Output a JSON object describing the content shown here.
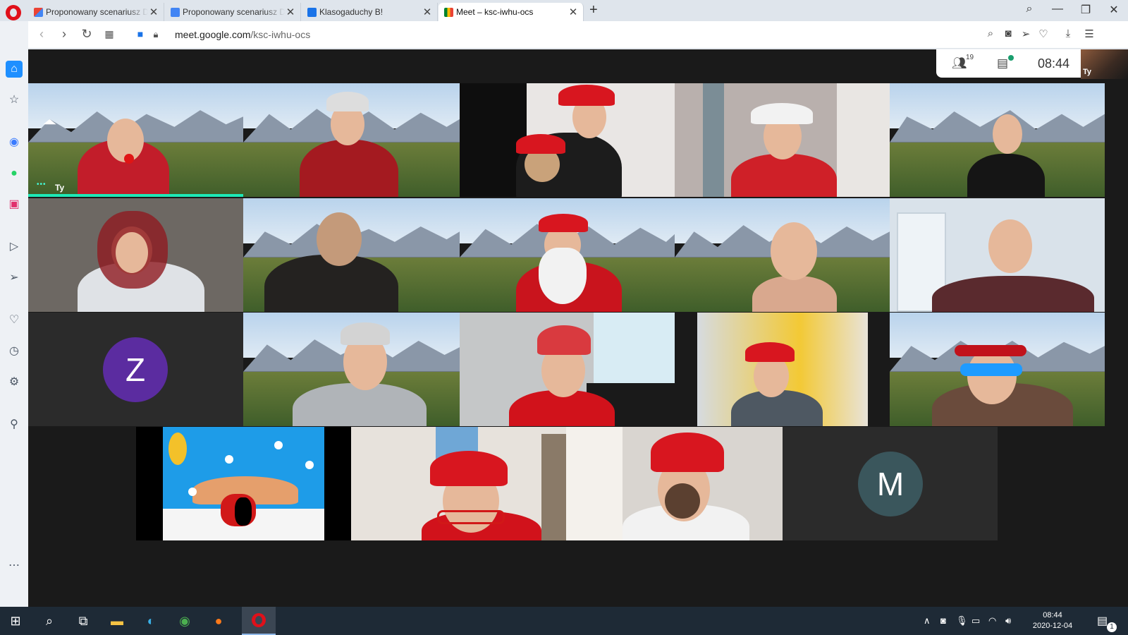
{
  "browser": {
    "tabs": [
      {
        "title": "Proponowany scenariusz D",
        "favicon": "gmail-icon",
        "active": false
      },
      {
        "title": "Proponowany scenariusz D",
        "favicon": "docs-icon",
        "active": false
      },
      {
        "title": "Klasogaduchy B!",
        "favicon": "classroom-icon",
        "active": false
      },
      {
        "title": "Meet – ksc-iwhu-ocs",
        "favicon": "meet-icon",
        "active": true
      }
    ],
    "url_domain": "meet.google.com",
    "url_path": "/ksc-iwhu-ocs",
    "colors": {
      "opera_red": "#e0101a",
      "tab_bg": "#dfe5ec",
      "meet_bg": "#1a1a1a"
    }
  },
  "meet": {
    "participant_count": "19",
    "clock": "08:44",
    "self_label": "Ty",
    "grid": {
      "tile_1_label": "Ty",
      "avatar_z": "Z",
      "avatar_m": "M",
      "avatar_z_color": "#5b2ca0",
      "avatar_m_color": "#3a565c",
      "active_speaker_color": "#1de9b6"
    }
  },
  "taskbar": {
    "time": "08:44",
    "date": "2020-12-04",
    "notification_count": "1"
  }
}
